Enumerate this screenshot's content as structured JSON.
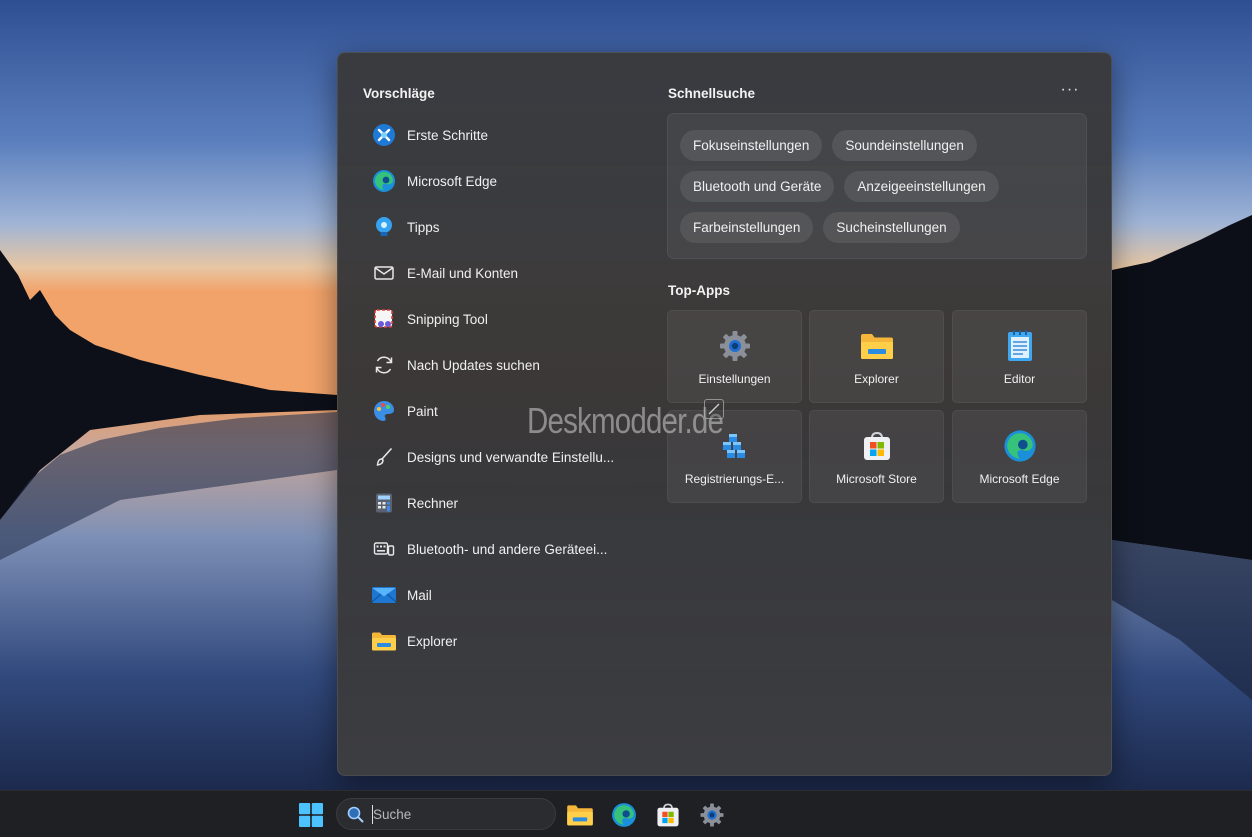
{
  "flyout": {
    "suggestions": {
      "title": "Vorschläge",
      "items": [
        {
          "label": "Erste Schritte",
          "icon": "get-started-icon"
        },
        {
          "label": "Microsoft Edge",
          "icon": "edge-icon"
        },
        {
          "label": "Tipps",
          "icon": "tips-icon"
        },
        {
          "label": "E-Mail und Konten",
          "icon": "mail-outline-icon"
        },
        {
          "label": "Snipping Tool",
          "icon": "snipping-tool-icon"
        },
        {
          "label": "Nach Updates suchen",
          "icon": "refresh-icon"
        },
        {
          "label": "Paint",
          "icon": "paint-icon"
        },
        {
          "label": "Designs und verwandte Einstellu...",
          "icon": "brush-icon"
        },
        {
          "label": "Rechner",
          "icon": "calculator-icon"
        },
        {
          "label": "Bluetooth- und andere Geräteei...",
          "icon": "devices-icon"
        },
        {
          "label": "Mail",
          "icon": "mail-app-icon"
        },
        {
          "label": "Explorer",
          "icon": "folder-icon"
        }
      ]
    },
    "quick_search": {
      "title": "Schnellsuche",
      "more_label": "···",
      "chips": [
        [
          "Fokuseinstellungen",
          "Soundeinstellungen"
        ],
        [
          "Bluetooth und Geräte",
          "Anzeigeeinstellungen"
        ],
        [
          "Farbeinstellungen",
          "Sucheinstellungen"
        ]
      ]
    },
    "top_apps": {
      "title": "Top-Apps",
      "apps": [
        {
          "label": "Einstellungen",
          "icon": "settings-gear-icon"
        },
        {
          "label": "Explorer",
          "icon": "folder-icon"
        },
        {
          "label": "Editor",
          "icon": "notepad-icon"
        },
        {
          "label": "Registrierungs-E...",
          "icon": "registry-icon"
        },
        {
          "label": "Microsoft Store",
          "icon": "store-icon"
        },
        {
          "label": "Microsoft Edge",
          "icon": "edge-icon"
        }
      ]
    }
  },
  "watermark": "Deskmodder.de",
  "taskbar": {
    "search_placeholder": "Suche",
    "pinned": [
      "folder-icon",
      "edge-icon",
      "store-icon",
      "settings-gear-icon"
    ]
  },
  "colors": {
    "accent": "#0078d4",
    "panel": "#3a3a3c",
    "taskbar": "#1f2024"
  }
}
